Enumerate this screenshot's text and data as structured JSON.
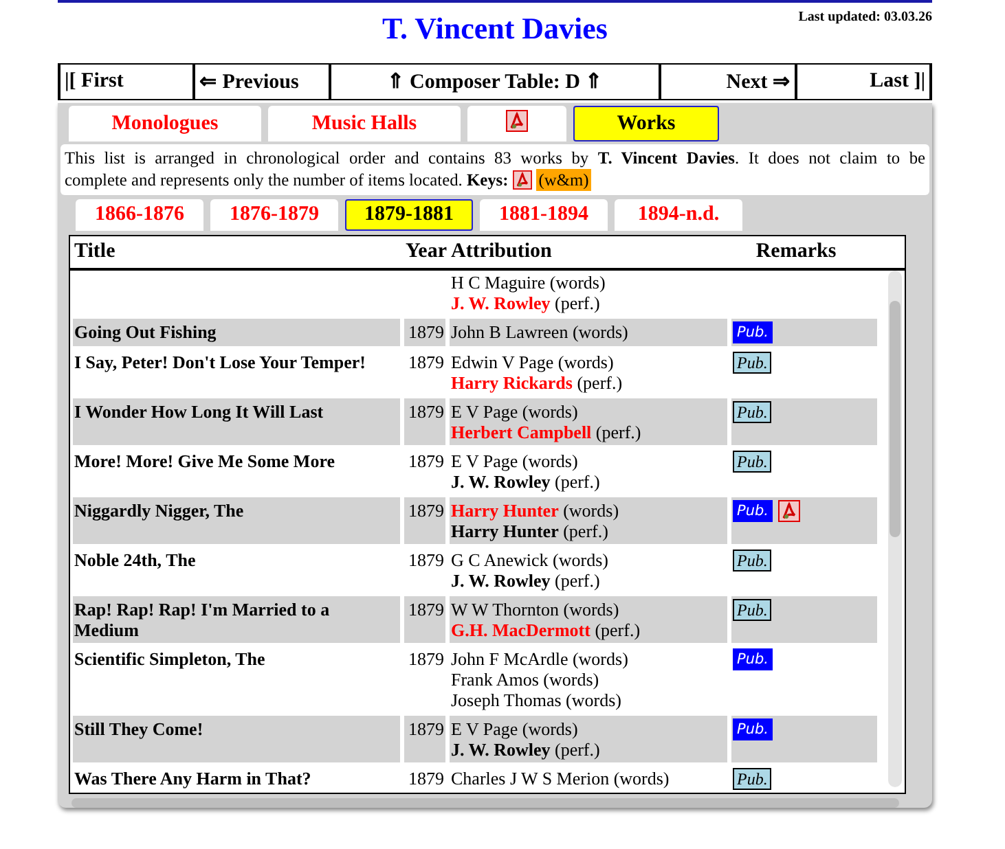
{
  "header": {
    "title": "T. Vincent Davies",
    "last_updated": "Last updated: 03.03.26"
  },
  "nav": [
    "|[ First",
    "⇐ Previous",
    "⇑ Composer Table: D ⇑",
    "Next ⇒",
    "Last ]|"
  ],
  "sections": [
    {
      "kind": "text",
      "label": "Monologues",
      "selected": false
    },
    {
      "kind": "text",
      "label": "Music Halls",
      "selected": false
    },
    {
      "kind": "pdf",
      "selected": false
    },
    {
      "kind": "text",
      "label": "Works",
      "selected": true
    }
  ],
  "intro": {
    "lines": [
      "This list is arranged in chronological order and contains 83 works by **T. Vincent Davies**. It does not claim to be",
      "complete and represents only the number of items located. **Keys:**"
    ],
    "keys": [
      {
        "kind": "pdf"
      },
      {
        "kind": "tag",
        "label": "(w&m)"
      }
    ]
  },
  "periods": [
    {
      "label": "1866-1876",
      "selected": false
    },
    {
      "label": "1876-1879",
      "selected": false
    },
    {
      "label": "1879-1881",
      "selected": true
    },
    {
      "label": "1881-1894",
      "selected": false
    },
    {
      "label": "1894-n.d.",
      "selected": false
    }
  ],
  "table": {
    "columns": [
      "Title",
      "Year",
      "Attribution",
      "Remarks"
    ],
    "rows": [
      {
        "attribution": [
          {
            "name": "H C Maguire",
            "role": "(words)",
            "kind": "plain"
          },
          {
            "name": "J. W. Rowley",
            "role": "(perf.)",
            "kind": "red"
          }
        ],
        "remarks": []
      },
      {
        "title": "Going Out Fishing",
        "year": "1879",
        "attribution": [
          {
            "name": "John B Lawreen",
            "role": "(words)",
            "kind": "plain"
          }
        ],
        "remarks": [
          {
            "kind": "pub-blue",
            "label": "Pub."
          }
        ]
      },
      {
        "title": "I Say, Peter! Don't Lose Your Temper!",
        "year": "1879",
        "attribution": [
          {
            "name": "Edwin V Page",
            "role": "(words)",
            "kind": "plain"
          },
          {
            "name": "Harry Rickards",
            "role": "(perf.)",
            "kind": "red"
          }
        ],
        "remarks": [
          {
            "kind": "pub-light",
            "label": "Pub."
          }
        ]
      },
      {
        "title": "I Wonder How Long It Will Last",
        "year": "1879",
        "attribution": [
          {
            "name": "E V Page",
            "role": "(words)",
            "kind": "plain"
          },
          {
            "name": "Herbert Campbell",
            "role": "(perf.)",
            "kind": "red"
          }
        ],
        "remarks": [
          {
            "kind": "pub-light",
            "label": "Pub."
          }
        ]
      },
      {
        "title": "More! More! Give Me Some More",
        "year": "1879",
        "attribution": [
          {
            "name": "E V Page",
            "role": "(words)",
            "kind": "plain"
          },
          {
            "name": "J. W. Rowley",
            "role": "(perf.)",
            "kind": "bold"
          }
        ],
        "remarks": [
          {
            "kind": "pub-light",
            "label": "Pub."
          }
        ]
      },
      {
        "title": "Niggardly Nigger, The",
        "year": "1879",
        "attribution": [
          {
            "name": "Harry Hunter",
            "role": "(words)",
            "kind": "red"
          },
          {
            "name": "Harry Hunter",
            "role": "(perf.)",
            "kind": "bold"
          }
        ],
        "remarks": [
          {
            "kind": "pub-blue",
            "label": "Pub."
          },
          {
            "kind": "pdf"
          }
        ]
      },
      {
        "title": "Noble 24th, The",
        "year": "1879",
        "attribution": [
          {
            "name": "G C Anewick",
            "role": "(words)",
            "kind": "plain"
          },
          {
            "name": "J. W. Rowley",
            "role": "(perf.)",
            "kind": "bold"
          }
        ],
        "remarks": [
          {
            "kind": "pub-light",
            "label": "Pub."
          }
        ]
      },
      {
        "title": "Rap! Rap! Rap! I'm Married to a Medium",
        "year": "1879",
        "attribution": [
          {
            "name": "W W Thornton",
            "role": "(words)",
            "kind": "plain"
          },
          {
            "name": "G.H. MacDermott",
            "role": "(perf.)",
            "kind": "red"
          }
        ],
        "remarks": [
          {
            "kind": "pub-light",
            "label": "Pub."
          }
        ]
      },
      {
        "title": "Scientific Simpleton, The",
        "year": "1879",
        "attribution": [
          {
            "name": "John F McArdle",
            "role": "(words)",
            "kind": "plain"
          },
          {
            "name": "Frank Amos",
            "role": "(words)",
            "kind": "plain"
          },
          {
            "name": "Joseph Thomas",
            "role": "(words)",
            "kind": "plain"
          }
        ],
        "remarks": [
          {
            "kind": "pub-blue",
            "label": "Pub."
          }
        ]
      },
      {
        "title": "Still They Come!",
        "year": "1879",
        "attribution": [
          {
            "name": "E V Page",
            "role": "(words)",
            "kind": "plain"
          },
          {
            "name": "J. W. Rowley",
            "role": "(perf.)",
            "kind": "bold"
          }
        ],
        "remarks": [
          {
            "kind": "pub-blue",
            "label": "Pub."
          }
        ]
      },
      {
        "title": "Was There Any Harm in That?",
        "year": "1879",
        "attribution": [
          {
            "name": "Charles J W S Merion",
            "role": "(words)",
            "kind": "plain"
          }
        ],
        "remarks": [
          {
            "kind": "pub-light",
            "label": "Pub."
          }
        ]
      }
    ]
  }
}
